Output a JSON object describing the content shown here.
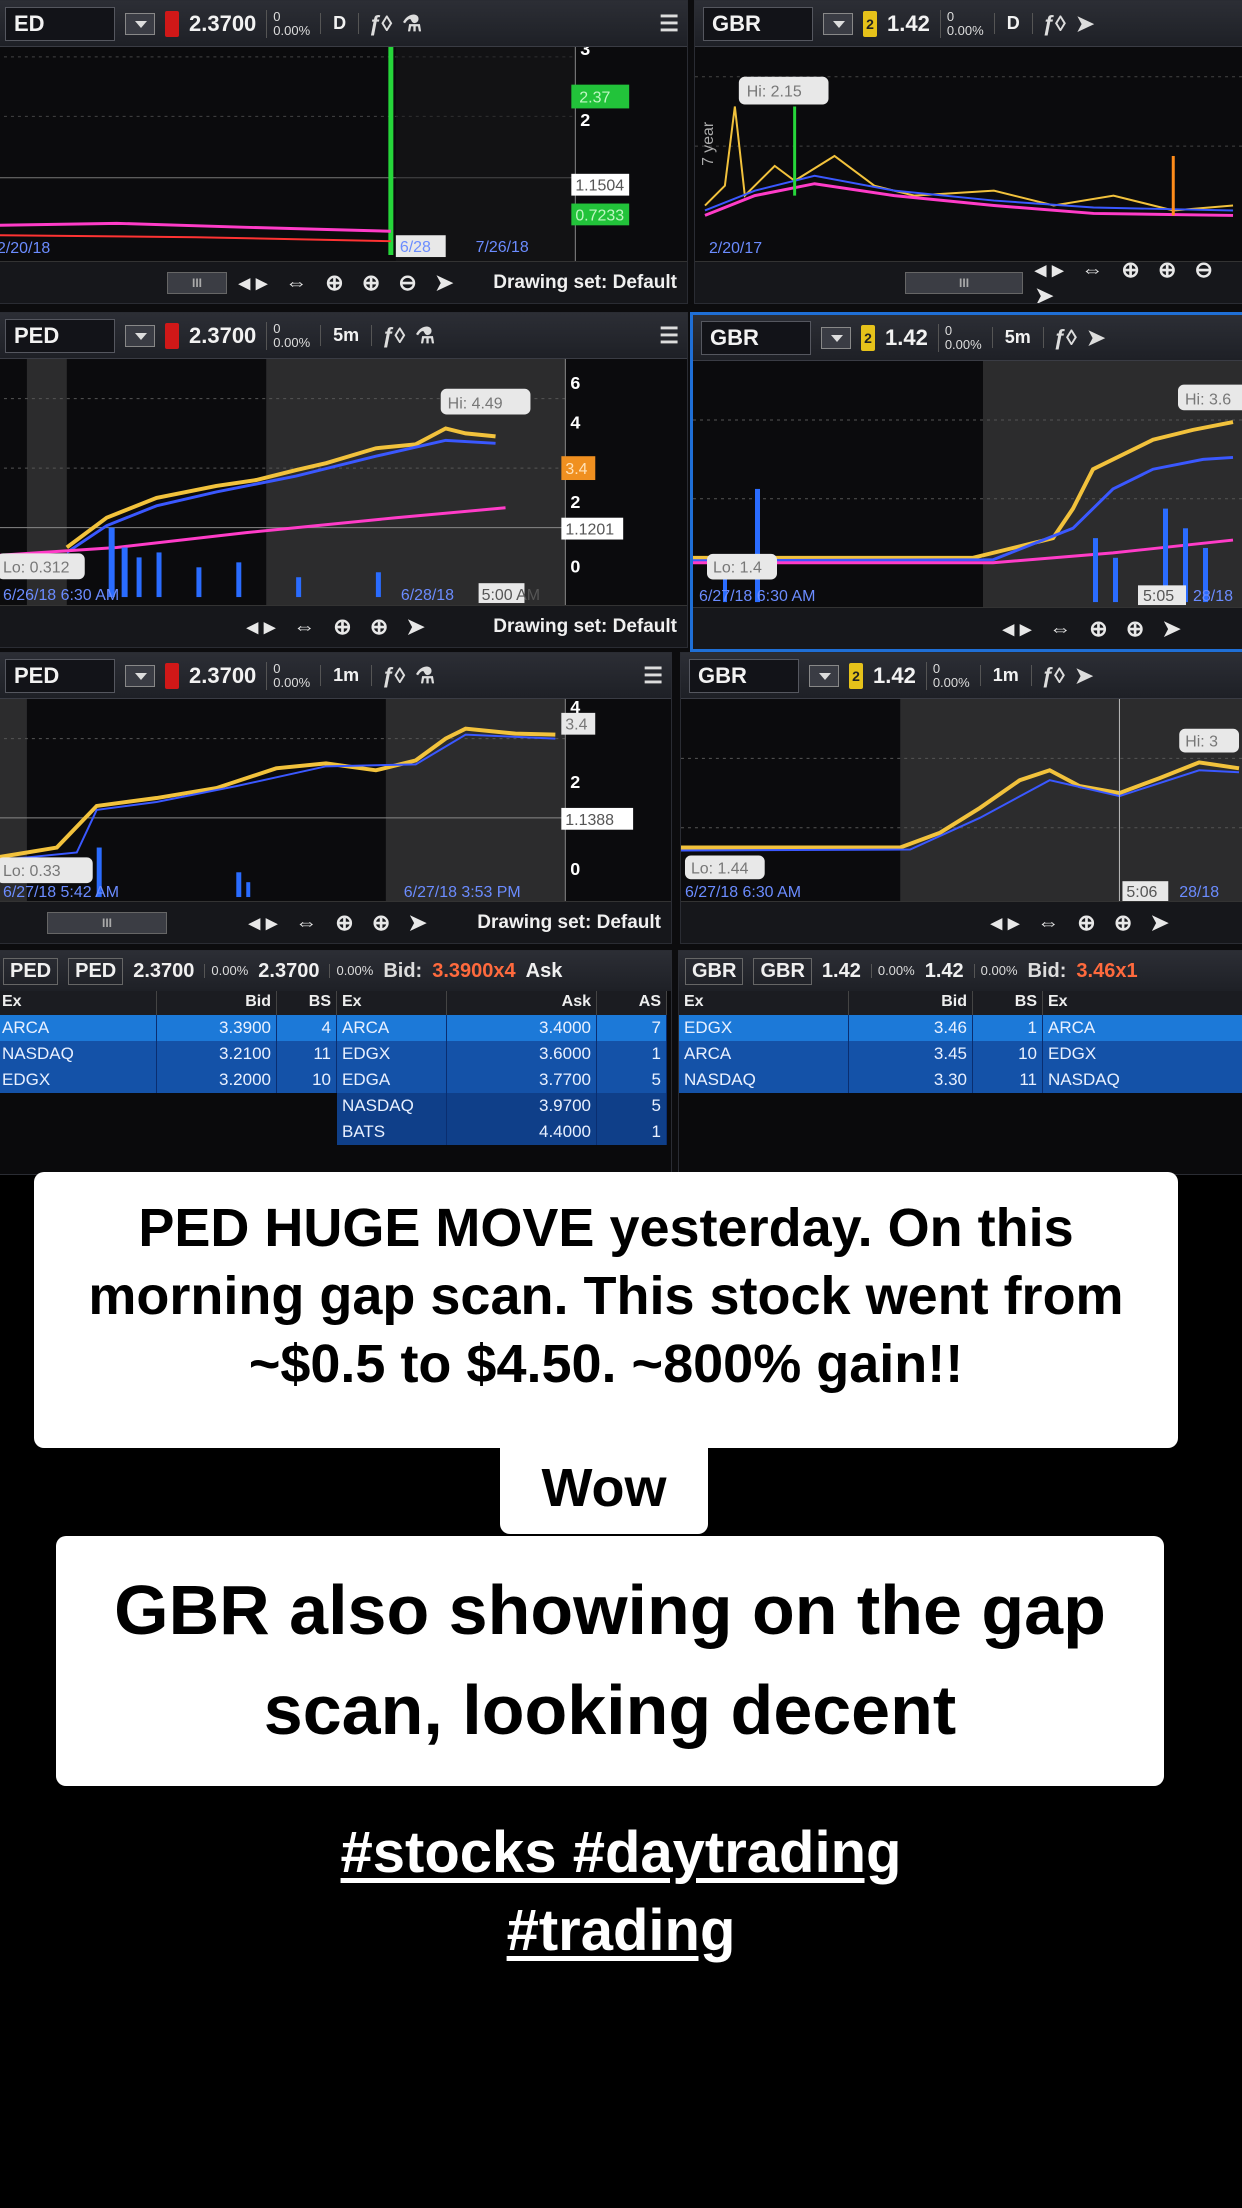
{
  "toolbar": {
    "drawing_set": "Drawing set: Default"
  },
  "panels": [
    {
      "symbol": "ED",
      "price": "2.3700",
      "change_top": "0",
      "change_bottom": "0.00%",
      "timeframe": "D",
      "ticks": [
        "3",
        "2"
      ],
      "price_tags": [
        "2.37",
        "1.1504",
        "0.7233"
      ],
      "dates": [
        "2/20/18",
        "6/28",
        "7/26/18"
      ],
      "hi_label": ""
    },
    {
      "symbol": "GBR",
      "price": "1.42",
      "change_top": "0",
      "change_bottom": "0.00%",
      "timeframe": "D",
      "ticks": [],
      "price_tags": [],
      "dates": [
        "2/20/17"
      ],
      "hi_label": "Hi: 2.15",
      "axis_note": "7 year"
    },
    {
      "symbol": "PED",
      "price": "2.3700",
      "change_top": "0",
      "change_bottom": "0.00%",
      "timeframe": "5m",
      "ticks": [
        "6",
        "4",
        "2",
        "0"
      ],
      "price_tags": [
        "3.4",
        "1.1201"
      ],
      "dates": [
        "6/26/18 6:30 AM",
        "6/28/18",
        "5:00 AM"
      ],
      "hi_label": "Hi: 4.49",
      "lo_label": "Lo: 0.312"
    },
    {
      "symbol": "GBR",
      "price": "1.42",
      "change_top": "0",
      "change_bottom": "0.00%",
      "timeframe": "5m",
      "ticks": [],
      "price_tags": [],
      "dates": [
        "6/27/18 6:30 AM",
        "5:05",
        "28/18"
      ],
      "hi_label": "Hi: 3.6",
      "lo_label": "Lo: 1.4"
    },
    {
      "symbol": "PED",
      "price": "2.3700",
      "change_top": "0",
      "change_bottom": "0.00%",
      "timeframe": "1m",
      "ticks": [
        "4",
        "2",
        "0"
      ],
      "price_tags": [
        "3.4",
        "1.1388"
      ],
      "dates": [
        "6/27/18 5:42 AM",
        "6/27/18 3:53 PM"
      ],
      "hi_label": "",
      "lo_label": "Lo: 0.33"
    },
    {
      "symbol": "GBR",
      "price": "1.42",
      "change_top": "0",
      "change_bottom": "0.00%",
      "timeframe": "1m",
      "ticks": [],
      "price_tags": [],
      "dates": [
        "6/27/18 6:30 AM",
        "5:06",
        "28/18"
      ],
      "hi_label": "Hi: 3",
      "lo_label": "Lo: 1.44"
    }
  ],
  "level2": [
    {
      "sym1": "PED",
      "sym2": "PED",
      "bid_price": "2.3700",
      "ask_price": "2.3700",
      "chg": "0.00%",
      "bid_label": "Bid:",
      "bid_value": "3.3900x4",
      "ask_label": "Ask",
      "bid_cols": [
        "Ex",
        "Bid",
        "BS"
      ],
      "ask_cols": [
        "Ex",
        "Ask",
        "AS"
      ],
      "bids": [
        {
          "ex": "ARCA",
          "price": "3.3900",
          "size": "4"
        },
        {
          "ex": "NASDAQ",
          "price": "3.2100",
          "size": "11"
        },
        {
          "ex": "EDGX",
          "price": "3.2000",
          "size": "10"
        }
      ],
      "asks": [
        {
          "ex": "ARCA",
          "price": "3.4000",
          "size": "7"
        },
        {
          "ex": "EDGX",
          "price": "3.6000",
          "size": "1"
        },
        {
          "ex": "EDGA",
          "price": "3.7700",
          "size": "5"
        },
        {
          "ex": "NASDAQ",
          "price": "3.9700",
          "size": "5"
        },
        {
          "ex": "BATS",
          "price": "4.4000",
          "size": "1"
        }
      ]
    },
    {
      "sym1": "GBR",
      "sym2": "GBR",
      "bid_price": "1.42",
      "ask_price": "1.42",
      "chg": "0.00%",
      "bid_label": "Bid:",
      "bid_value": "3.46x1",
      "ask_label": "",
      "bid_cols": [
        "Ex",
        "Bid",
        "BS"
      ],
      "ask_cols": [
        "Ex"
      ],
      "bids": [
        {
          "ex": "EDGX",
          "price": "3.46",
          "size": "1"
        },
        {
          "ex": "ARCA",
          "price": "3.45",
          "size": "10"
        },
        {
          "ex": "NASDAQ",
          "price": "3.30",
          "size": "11"
        }
      ],
      "asks": [
        {
          "ex": "ARCA",
          "price": "",
          "size": ""
        },
        {
          "ex": "EDGX",
          "price": "",
          "size": ""
        },
        {
          "ex": "NASDAQ",
          "price": "",
          "size": ""
        }
      ]
    }
  ],
  "captions": {
    "caption1": "PED HUGE MOVE yesterday. On this morning gap scan. This stock went from ~$0.5 to $4.50. ~800% gain!!",
    "caption1_tail": "Wow",
    "caption2": "GBR also showing on the gap scan, looking decent",
    "hashtags_line1": "#stocks #daytrading",
    "hashtags_line2": "#trading"
  },
  "colors": {
    "accent_blue": "#1f6fd6",
    "green_tag": "#22c33a",
    "orange_tag": "#f09020",
    "sma_magenta": "#ff3cc8",
    "sma_blue": "#3a58ff"
  }
}
